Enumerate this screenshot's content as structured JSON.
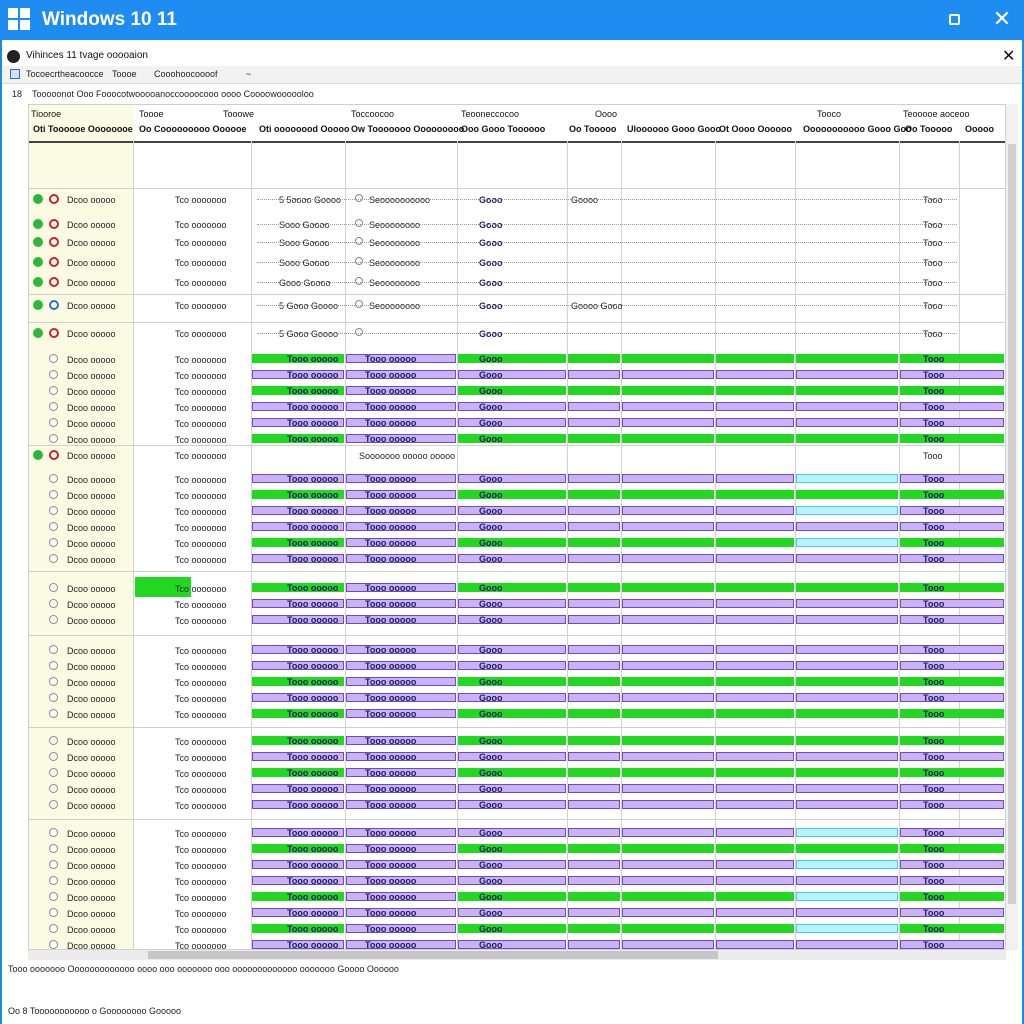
{
  "window": {
    "title": "Windows 10 11",
    "doc_title": "Vihinces 11 tvage ooooaion",
    "close_glyph": "✕",
    "doc_close_glyph": "✕"
  },
  "toolbar": {
    "items": [
      "Tocoecrtheacoocce",
      "Toooe",
      "Cooohoocoooof",
      "~"
    ]
  },
  "infobar": {
    "left": "18",
    "text": "Tooooonot Ooo Fooocotwooooanoccoooocooo oooo Coooowoooooloo"
  },
  "grid": {
    "group_headers": [
      "Tiooroe",
      "Toooe",
      "Tooowe",
      "Toccoocoo",
      "Teooneccocoo",
      "Oooo",
      "Tooco",
      "Teooooe aoceoo"
    ],
    "column_headers": [
      "Oti Toooooe Oooooooe",
      "Oo Cooooooooo Oooooe",
      "Oti oooooood Ooooo",
      "Ow Tooooooo Ooooooooo",
      "Ooo Gooo Toooooo",
      "Oo Tooooo",
      "Uloooooo Gooo Gooo",
      "Ot Oooo Oooooo",
      "Ooooooooooo Gooo Goo",
      "Oo Tooooo",
      "Ooooo"
    ],
    "rows": [
      {
        "s1": "green",
        "s2": "red",
        "name": "Dcoo ooooo",
        "c2": "Tco ooooooo",
        "c3": "5 5oooo Goooo",
        "c4": "Seoooooooooo",
        "c5": "Gooo",
        "c6": "Goooo",
        "c7": "Tooo"
      },
      {
        "s1": "green",
        "s2": "red",
        "name": "Dcoo ooooo",
        "c2": "Tco ooooooo",
        "c3": "Sooo Goooo",
        "c4": "Seoooooooo",
        "c5": "Gooo",
        "c6": "",
        "c7": "Tooo"
      },
      {
        "s1": "green",
        "s2": "red",
        "name": "Dcoo ooooo",
        "c2": "Tco ooooooo",
        "c3": "Sooo Goooo",
        "c4": "Seoooooooo",
        "c5": "Gooo",
        "c6": "",
        "c7": "Tooo"
      },
      {
        "s1": "green",
        "s2": "red",
        "name": "Dcoo ooooo",
        "c2": "Tco ooooooo",
        "c3": "Sooo Goooo",
        "c4": "Seoooooooo",
        "c5": "Gooo",
        "c6": "",
        "c7": "Tooo"
      },
      {
        "s1": "green",
        "s2": "red",
        "name": "Dcoo ooooo",
        "c2": "Tco ooooooo",
        "c3": "Gooo Goooo",
        "c4": "Seoooooooo",
        "c5": "Gooo",
        "c6": "",
        "c7": "Tooo"
      },
      {
        "s1": "green",
        "s2": "ring",
        "name": "Dcoo ooooo",
        "c2": "Tco ooooooo",
        "c3": "5 Gooo Goooo",
        "c4": "Seoooooooo",
        "c5": "Gooo",
        "c6": "Goooo Gooo",
        "c7": "Tooo"
      },
      {
        "s1": "green",
        "s2": "red",
        "name": "Dcoo ooooo",
        "c2": "Tco ooooooo",
        "c3": "5 Gooo Goooo",
        "c4": "",
        "c5": "Gooo",
        "c6": "",
        "c7": "Tooo"
      }
    ],
    "bar_rows_a": [
      {
        "label": "Dcoo ooooo",
        "c2": "Tco ooooooo",
        "t1": "Tooo ooooo",
        "t2": "Tooo ooooo",
        "t3": "Gooo",
        "t4": "Tooo"
      },
      {
        "label": "Dcoo ooooo",
        "c2": "Tco ooooooo",
        "t1": "Tooo ooooo",
        "t2": "Tooo ooooo",
        "t3": "Gooo",
        "t4": "Tooo"
      },
      {
        "label": "Dcoo ooooo",
        "c2": "Tco ooooooo",
        "t1": "Tooo ooooo",
        "t2": "Tooo ooooo",
        "t3": "Gooo",
        "t4": "Tooo"
      },
      {
        "label": "Dcoo ooooo",
        "c2": "Tco ooooooo",
        "t1": "Tooo ooooo",
        "t2": "Tooo ooooo",
        "t3": "Gooo",
        "t4": "Tooo"
      },
      {
        "label": "Dcoo ooooo",
        "c2": "Tco ooooooo",
        "t1": "Tooo ooooo",
        "t2": "Tooo ooooo",
        "t3": "Gooo",
        "t4": "Tooo"
      }
    ],
    "section_rows": [
      {
        "name": "Dcoo ooooo",
        "c2": "Tco ooooooo",
        "c3": "Sooooooo ooooo ooooo",
        "t4": "Tooo"
      }
    ]
  },
  "status": {
    "line1": "Tooo ooooooo Ooooooooooooo oooo ooo ooooooo ooo ooooooooooooo ooooooo Goooo Oooooo",
    "line2": "Oo 8 Tooooooooooo o Goooooooo Gooooo"
  }
}
